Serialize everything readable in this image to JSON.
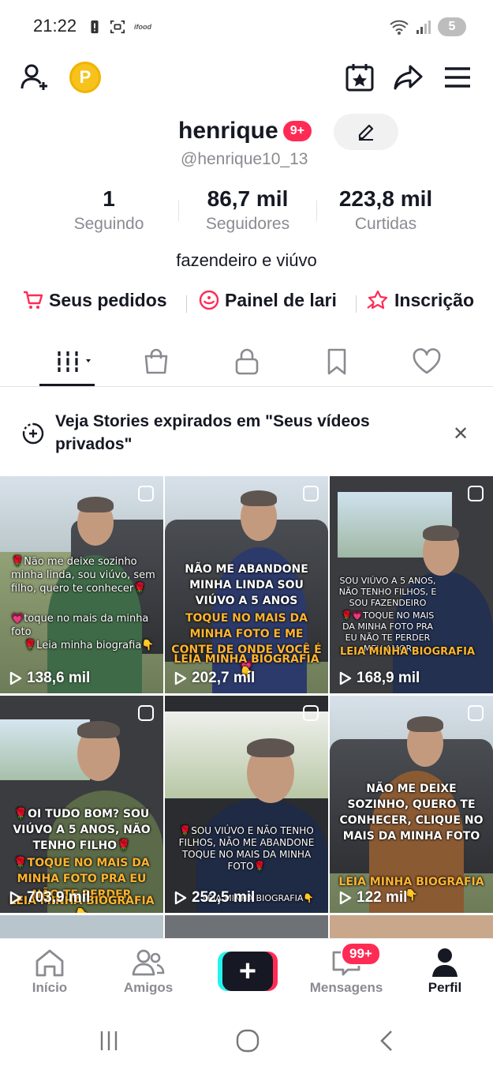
{
  "status": {
    "time": "21:22",
    "ifood": "ifood",
    "battery": "5"
  },
  "profile": {
    "username": "henrique",
    "badge": "9+",
    "handle": "@henrique10_13",
    "bio": "fazendeiro e viúvo"
  },
  "stats": [
    {
      "value": "1",
      "label": "Seguindo"
    },
    {
      "value": "86,7 mil",
      "label": "Seguidores"
    },
    {
      "value": "223,8 mil",
      "label": "Curtidas"
    }
  ],
  "links": [
    {
      "label": "Seus pedidos",
      "icon": "cart-icon"
    },
    {
      "label": "Painel de lari",
      "icon": "dashboard-icon"
    },
    {
      "label": "Inscrição",
      "icon": "star-badge-icon"
    }
  ],
  "stories_banner": {
    "text": "Veja Stories expirados em \"Seus vídeos privados\""
  },
  "videos": [
    {
      "views": "138,6 mil",
      "lines": [
        "🌹Não me deixe sozinho minha linda, sou viúvo, sem filho, quero te conhecer🌹",
        "💗toque no mais da minha foto",
        "🌹Leia minha biografia👇"
      ]
    },
    {
      "views": "202,7 mil",
      "lines": [
        "NÃO ME ABANDONE MINHA LINDA SOU VIÚVO A 5 ANOS",
        "TOQUE NO MAIS DA MINHA FOTO E ME CONTE DE ONDE VOCÊ É💗",
        "LEIA MINHA BIOGRAFIA👇"
      ]
    },
    {
      "views": "168,9 mil",
      "lines": [
        "SOU VIÚVO A 5 ANOS, NÃO TENHO FILHOS, E SOU FAZENDEIRO",
        "🌹💗TOQUE NO MAIS DA MINHA FOTO PRA EU NÃO TE PERDER MEU AMOR",
        "LEIA MINHA BIOGRAFIA"
      ]
    },
    {
      "views": "703,9 mil",
      "lines": [
        "🌹OI TUDO BOM? SOU VIÚVO A 5 ANOS, NÃO TENHO FILHO🌹",
        "🌹TOQUE NO MAIS DA MINHA FOTO PRA EU NÃO TE PERDER",
        "LEIA MINHA BIOGRAFIA👇"
      ]
    },
    {
      "views": "252,5 mil",
      "lines": [
        "🌹SOU VIÚVO E NÃO TENHO FILHOS, NÃO ME ABANDONE TOQUE NO MAIS DA MINHA FOTO🌹",
        "LEIA MINHA BIOGRAFIA👇"
      ]
    },
    {
      "views": "122 mil",
      "lines": [
        "NÃO ME DEIXE SOZINHO, QUERO TE CONHECER, CLIQUE NO MAIS DA MINHA FOTO",
        "LEIA MINHA BIOGRAFIA👇"
      ]
    }
  ],
  "bottom_nav": [
    {
      "label": "Início",
      "icon": "home-icon"
    },
    {
      "label": "Amigos",
      "icon": "friends-icon"
    },
    {
      "label": "",
      "icon": "plus-icon"
    },
    {
      "label": "Mensagens",
      "icon": "inbox-icon"
    },
    {
      "label": "Perfil",
      "icon": "profile-icon"
    }
  ],
  "messages_badge": "99+",
  "colors": {
    "accent": "#fe2c55",
    "cyan": "#25f4ee",
    "text": "#161823",
    "muted": "#8a8b91",
    "coin": "#f7c21b"
  }
}
